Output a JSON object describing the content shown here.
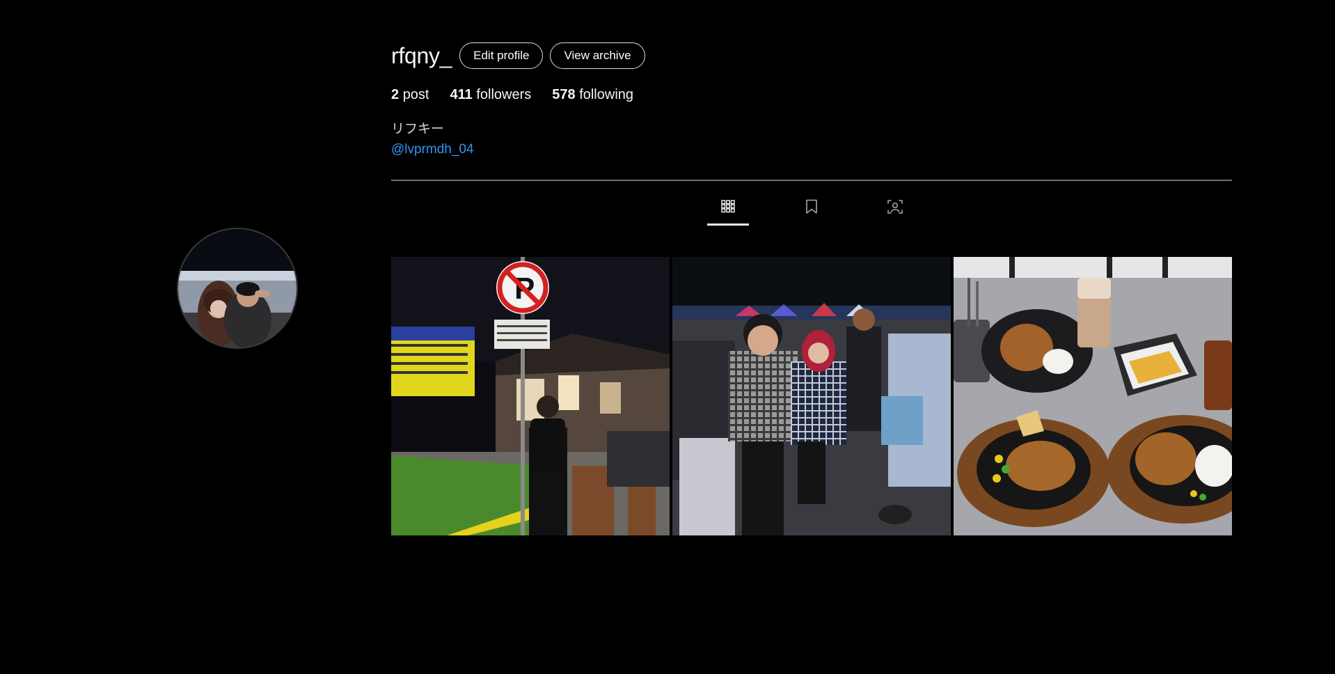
{
  "profile": {
    "username": "rfqny_",
    "edit_button": "Edit profile",
    "archive_button": "View archive",
    "avatar_icon": "profile-photo"
  },
  "stats": {
    "posts_count": "2",
    "posts_label": "post",
    "followers_count": "411",
    "followers_label": "followers",
    "following_count": "578",
    "following_label": "following"
  },
  "bio": {
    "name": "リフキー",
    "mention": "@lvprmdh_04"
  },
  "tabs": [
    {
      "icon": "grid-icon",
      "active": true
    },
    {
      "icon": "bookmark-icon",
      "active": false
    },
    {
      "icon": "tagged-person-icon",
      "active": false
    }
  ],
  "posts": [
    {
      "subject": "night-street-parking-sign"
    },
    {
      "subject": "night-festival-couple"
    },
    {
      "subject": "chicken-steak-meal"
    }
  ],
  "colors": {
    "background": "#000000",
    "text": "#f5f5f5",
    "link": "#2f97f2",
    "divider": "#6e6e6e"
  }
}
